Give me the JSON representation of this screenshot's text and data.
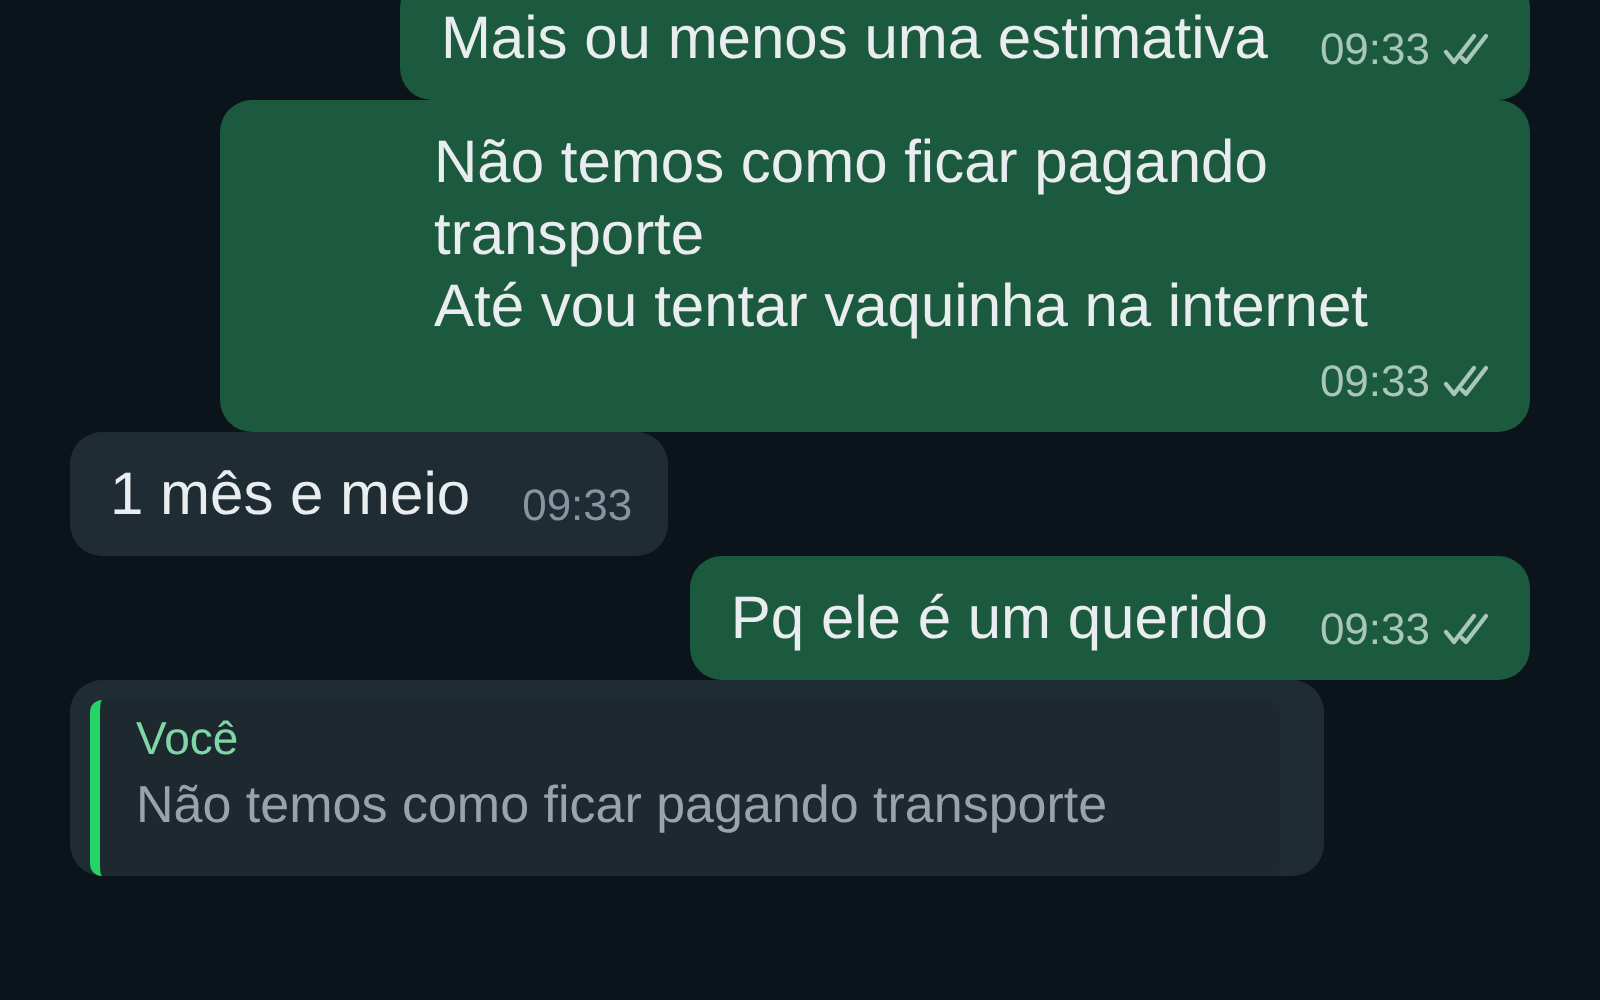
{
  "messages": [
    {
      "kind": "outgoing",
      "text": "Mais ou menos uma estimativa",
      "time": "09:33",
      "read": false
    },
    {
      "kind": "outgoing",
      "text": "Não temos como ficar pagando transporte\nAté vou tentar vaquinha na internet",
      "time": "09:33",
      "read": false
    },
    {
      "kind": "incoming",
      "text": "1 mês e meio",
      "time": "09:33"
    },
    {
      "kind": "outgoing",
      "text": "Pq ele é um querido",
      "time": "09:33",
      "read": false
    },
    {
      "kind": "incoming",
      "quote": {
        "author": "Você",
        "text": "Não temos como ficar pagando transporte"
      }
    }
  ]
}
